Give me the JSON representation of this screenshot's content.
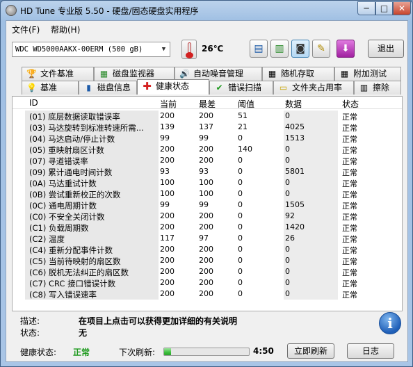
{
  "window": {
    "title": "HD Tune 专业版 5.50 - 硬盘/固态硬盘实用程序",
    "controls": {
      "minimize": "─",
      "maximize": "□",
      "close": "✕"
    }
  },
  "menu": {
    "file": "文件(F)",
    "help": "帮助(H)"
  },
  "toolbar": {
    "drive": "WDC WD5000AAKX-00ERM (500 gB)",
    "temperature": "26℃",
    "buttons": [
      {
        "icon": "copy-info-icon",
        "glyph": "▤"
      },
      {
        "icon": "copy-screen-icon",
        "glyph": "▥"
      },
      {
        "icon": "camera-icon",
        "glyph": "◙"
      },
      {
        "icon": "options-icon",
        "glyph": "✎"
      },
      {
        "icon": "save-down-icon",
        "glyph": "⬇"
      }
    ],
    "exit": "退出"
  },
  "tabs": {
    "row1": [
      {
        "label": "文件基准",
        "icon": "file-benchmark-icon",
        "glyph": "🏆"
      },
      {
        "label": "磁盘监视器",
        "icon": "disk-monitor-icon",
        "glyph": "▦"
      },
      {
        "label": "自动噪音管理",
        "icon": "speaker-icon",
        "glyph": "🔊"
      },
      {
        "label": "随机存取",
        "icon": "random-access-icon",
        "glyph": "▦"
      },
      {
        "label": "附加测试",
        "icon": "extra-tests-icon",
        "glyph": "▦"
      }
    ],
    "row2": [
      {
        "label": "基准",
        "icon": "benchmark-icon",
        "glyph": "💡"
      },
      {
        "label": "磁盘信息",
        "icon": "disk-info-icon",
        "glyph": "▮"
      },
      {
        "label": "健康状态",
        "icon": "health-cross-icon",
        "glyph": "✚"
      },
      {
        "label": "错误扫描",
        "icon": "error-scan-icon",
        "glyph": "✔"
      },
      {
        "label": "文件夹占用率",
        "icon": "folder-icon",
        "glyph": "▭"
      },
      {
        "label": "擦除",
        "icon": "erase-bin-icon",
        "glyph": "▥"
      }
    ]
  },
  "table": {
    "columns": [
      "ID",
      "当前",
      "最差",
      "阈值",
      "数据",
      "状态"
    ],
    "rows": [
      {
        "id": "(01) 底层数据读取错误率",
        "cur": "200",
        "worst": "200",
        "thr": "51",
        "data": "0",
        "status": "正常"
      },
      {
        "id": "(03) 马达旋转到标准转速所需...",
        "cur": "139",
        "worst": "137",
        "thr": "21",
        "data": "4025",
        "status": "正常"
      },
      {
        "id": "(04) 马达启动/停止计数",
        "cur": "99",
        "worst": "99",
        "thr": "0",
        "data": "1513",
        "status": "正常"
      },
      {
        "id": "(05) 重映射扇区计数",
        "cur": "200",
        "worst": "200",
        "thr": "140",
        "data": "0",
        "status": "正常"
      },
      {
        "id": "(07) 寻道错误率",
        "cur": "200",
        "worst": "200",
        "thr": "0",
        "data": "0",
        "status": "正常"
      },
      {
        "id": "(09) 累计通电时间计数",
        "cur": "93",
        "worst": "93",
        "thr": "0",
        "data": "5801",
        "status": "正常"
      },
      {
        "id": "(0A) 马达重试计数",
        "cur": "100",
        "worst": "100",
        "thr": "0",
        "data": "0",
        "status": "正常"
      },
      {
        "id": "(0B) 尝试重新校正的次数",
        "cur": "100",
        "worst": "100",
        "thr": "0",
        "data": "0",
        "status": "正常"
      },
      {
        "id": "(0C) 通电周期计数",
        "cur": "99",
        "worst": "99",
        "thr": "0",
        "data": "1505",
        "status": "正常"
      },
      {
        "id": "(C0) 不安全关闭计数",
        "cur": "200",
        "worst": "200",
        "thr": "0",
        "data": "92",
        "status": "正常"
      },
      {
        "id": "(C1) 负载周期数",
        "cur": "200",
        "worst": "200",
        "thr": "0",
        "data": "1420",
        "status": "正常"
      },
      {
        "id": "(C2) 温度",
        "cur": "117",
        "worst": "97",
        "thr": "0",
        "data": "26",
        "status": "正常"
      },
      {
        "id": "(C4) 重新分配事件计数",
        "cur": "200",
        "worst": "200",
        "thr": "0",
        "data": "0",
        "status": "正常"
      },
      {
        "id": "(C5) 当前待映射的扇区数",
        "cur": "200",
        "worst": "200",
        "thr": "0",
        "data": "0",
        "status": "正常"
      },
      {
        "id": "(C6) 脱机无法纠正的扇区数",
        "cur": "200",
        "worst": "200",
        "thr": "0",
        "data": "0",
        "status": "正常"
      },
      {
        "id": "(C7) CRC 接口错误计数",
        "cur": "200",
        "worst": "200",
        "thr": "0",
        "data": "0",
        "status": "正常"
      },
      {
        "id": "(C8) 写入错误速率",
        "cur": "200",
        "worst": "200",
        "thr": "0",
        "data": "0",
        "status": "正常"
      }
    ]
  },
  "description": {
    "desc_label": "描述:",
    "desc_value": "在项目上点击可以获得更加详细的有关说明",
    "state_label": "状态:",
    "state_value": "无",
    "info_glyph": "i"
  },
  "status": {
    "health_label": "健康状态:",
    "health_value": "正常",
    "refresh_label": "下次刷新:",
    "refresh_progress": 0.08,
    "countdown": "4:50",
    "refresh_now": "立即刷新",
    "log": "日志"
  },
  "colors": {
    "ok_green": "#1e9a1e",
    "health_cross": "#d42020",
    "info_blue": "#1f5fb8"
  }
}
